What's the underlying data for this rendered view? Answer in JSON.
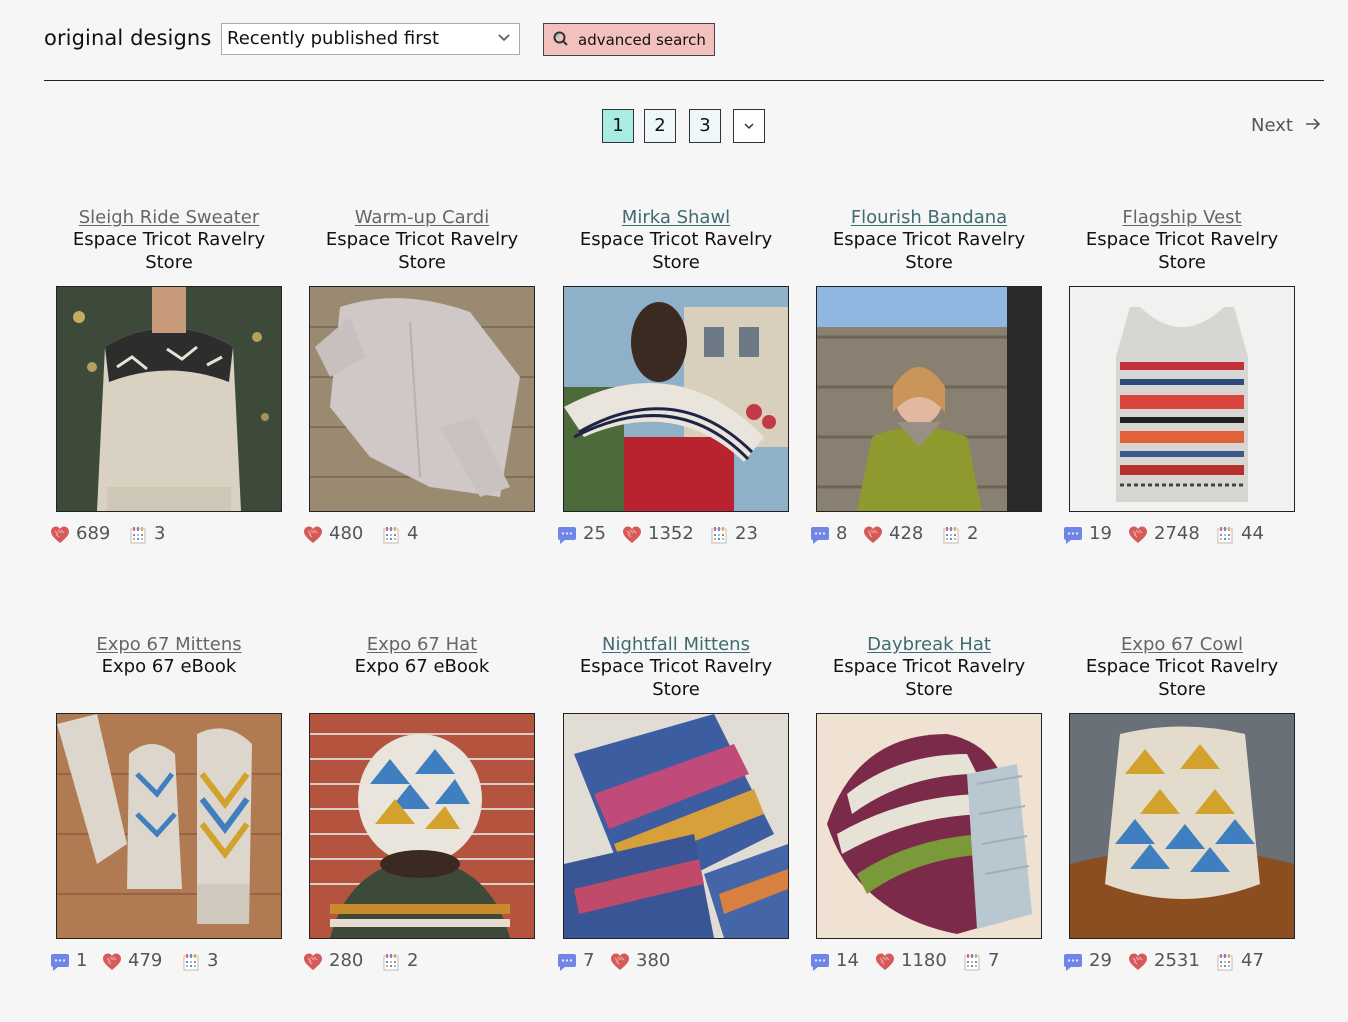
{
  "header": {
    "heading": "original designs",
    "sort_value": "Recently published first",
    "advanced_search_label": "advanced search"
  },
  "pagination": {
    "pages": [
      "1",
      "2",
      "3"
    ],
    "current": "1",
    "next_label": "Next"
  },
  "designs": [
    {
      "title": "Sleigh Ride Sweater",
      "source": "Espace Tricot Ravelry Store",
      "comments": null,
      "hearts": "689",
      "projects": "3"
    },
    {
      "title": "Warm-up Cardi",
      "source": "Espace Tricot Ravelry Store",
      "comments": null,
      "hearts": "480",
      "projects": "4"
    },
    {
      "title": "Mirka Shawl",
      "source": "Espace Tricot Ravelry Store",
      "comments": "25",
      "hearts": "1352",
      "projects": "23"
    },
    {
      "title": "Flourish Bandana",
      "source": "Espace Tricot Ravelry Store",
      "comments": "8",
      "hearts": "428",
      "projects": "2"
    },
    {
      "title": "Flagship Vest",
      "source": "Espace Tricot Ravelry Store",
      "comments": "19",
      "hearts": "2748",
      "projects": "44"
    },
    {
      "title": "Expo 67 Mittens",
      "source": "Expo 67 eBook",
      "comments": "1",
      "hearts": "479",
      "projects": "3"
    },
    {
      "title": "Expo 67 Hat",
      "source": "Expo 67 eBook",
      "comments": null,
      "hearts": "280",
      "projects": "2"
    },
    {
      "title": "Nightfall Mittens",
      "source": "Espace Tricot Ravelry Store",
      "comments": "7",
      "hearts": "380",
      "projects": null
    },
    {
      "title": "Daybreak Hat",
      "source": "Espace Tricot Ravelry Store",
      "comments": "14",
      "hearts": "1180",
      "projects": "7"
    },
    {
      "title": "Expo 67 Cowl",
      "source": "Espace Tricot Ravelry Store",
      "comments": "29",
      "hearts": "2531",
      "projects": "47"
    }
  ],
  "icons": {
    "comment": "comment-bubble-icon",
    "heart": "heart-icon",
    "projects": "projects-icon",
    "search": "search-icon",
    "dropdown": "chevron-down-icon",
    "next": "arrow-right-icon"
  },
  "colors": {
    "background": "#f6f6f6",
    "active_page": "#a9ece4",
    "advanced_search_bg": "#f2c0bd",
    "heart": "#d65a5a",
    "comment": "#6f86e8",
    "link_teal": "#3f6b72"
  }
}
